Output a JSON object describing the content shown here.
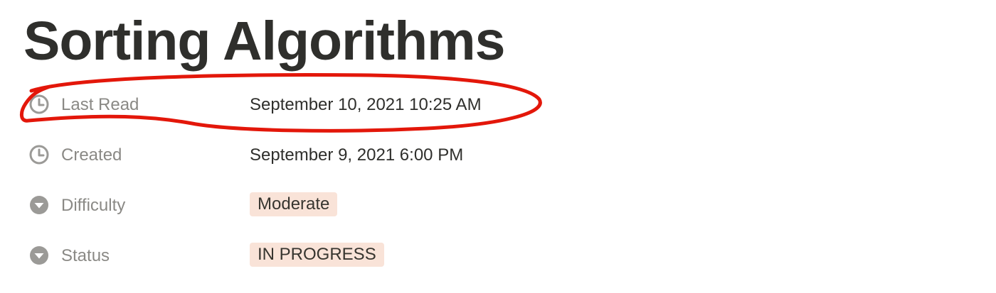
{
  "page": {
    "title": "Sorting Algorithms"
  },
  "properties": [
    {
      "name": "Last Read",
      "icon": "clock-icon",
      "value": "September 10, 2021 10:25 AM",
      "type": "date"
    },
    {
      "name": "Created",
      "icon": "clock-icon",
      "value": "September 9, 2021 6:00 PM",
      "type": "date"
    },
    {
      "name": "Difficulty",
      "icon": "select-icon",
      "value": "Moderate",
      "type": "select",
      "tag_color": "#f9e3d8"
    },
    {
      "name": "Status",
      "icon": "select-icon",
      "value": "IN PROGRESS",
      "type": "select",
      "tag_color": "#f9e3d8"
    }
  ],
  "annotation": {
    "shape": "hand-drawn-circle",
    "color": "#e3170a",
    "encircles": "Last Read"
  }
}
